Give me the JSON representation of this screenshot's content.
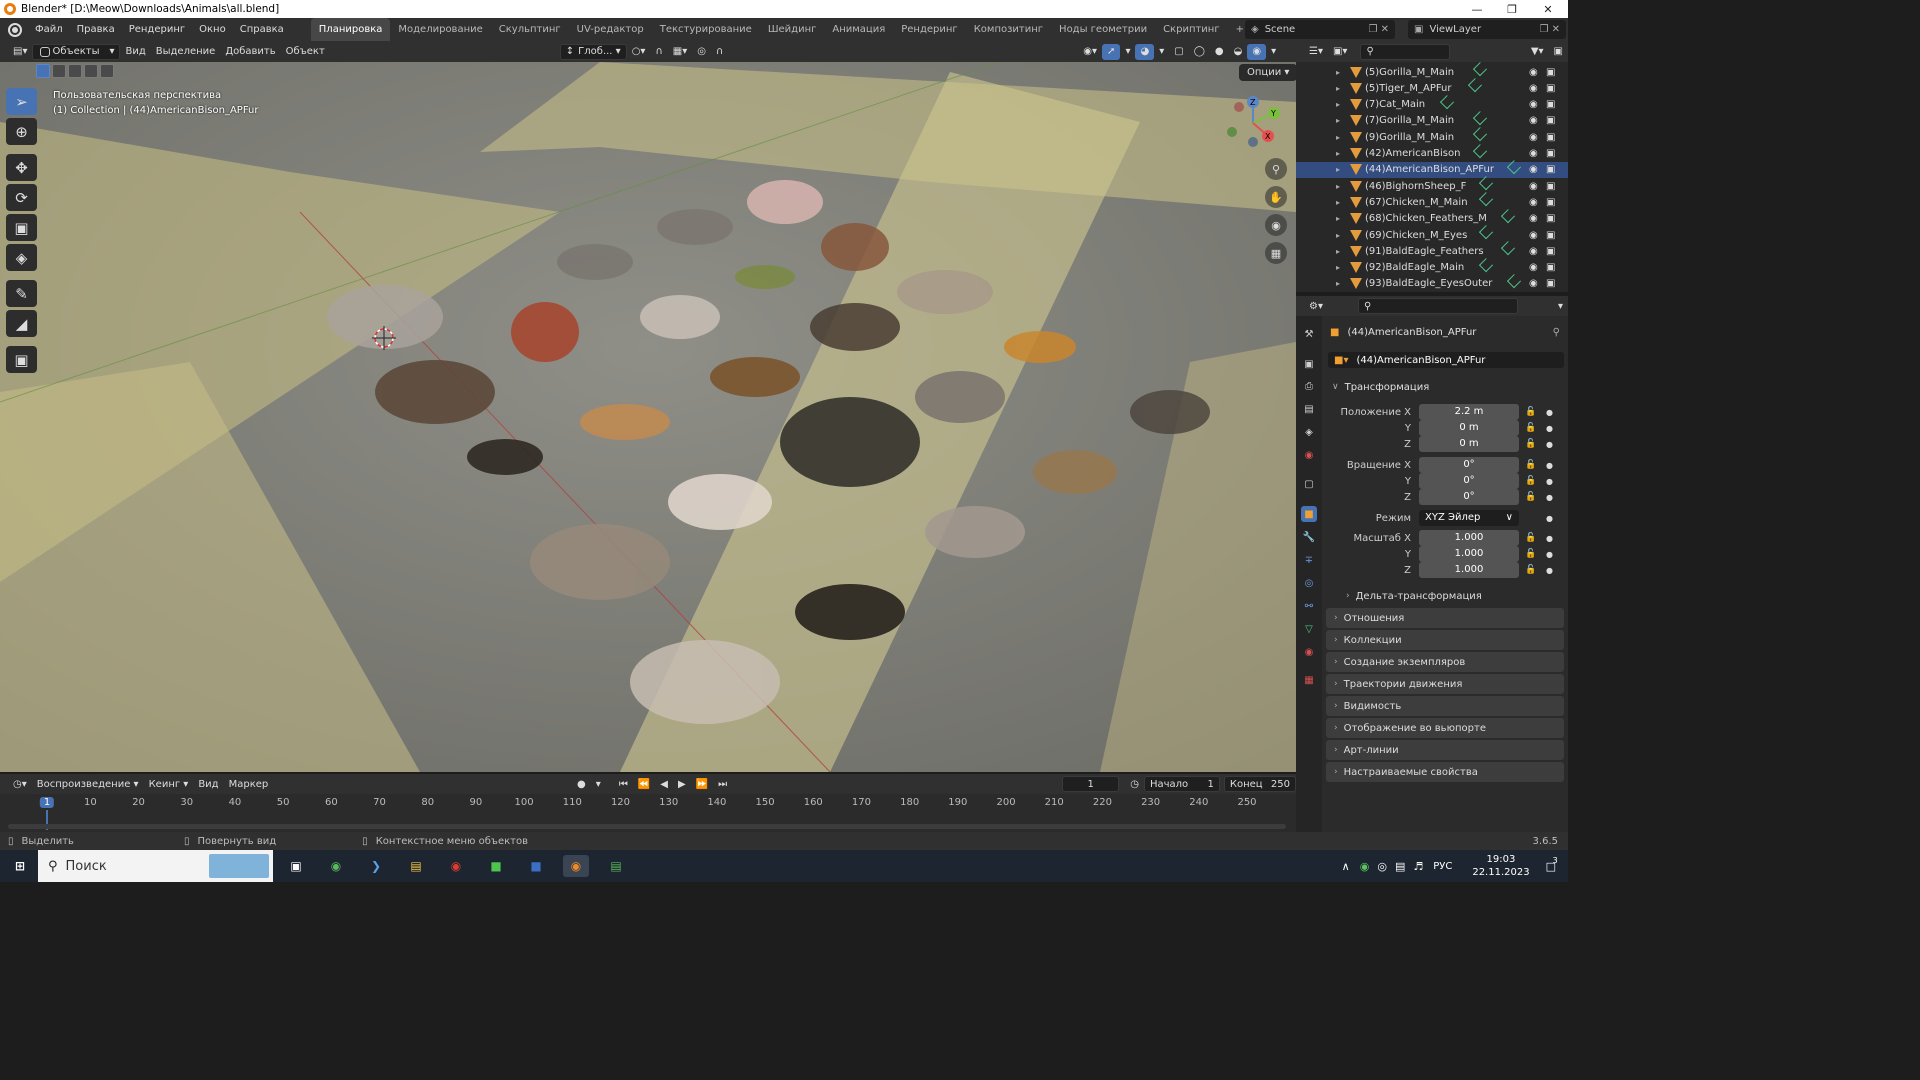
{
  "window": {
    "title": "Blender* [D:\\Meow\\Downloads\\Animals\\all.blend]"
  },
  "menu": {
    "items": [
      "Файл",
      "Правка",
      "Рендеринг",
      "Окно",
      "Справка"
    ]
  },
  "workspaces": {
    "tabs": [
      "Планировка",
      "Моделирование",
      "Скульптинг",
      "UV-редактор",
      "Текстурирование",
      "Шейдинг",
      "Анимация",
      "Рендеринг",
      "Композитинг",
      "Ноды геометрии",
      "Скриптинг"
    ],
    "active": "Планировка",
    "add": "+"
  },
  "scene": {
    "name": "Scene",
    "view_layer": "ViewLayer"
  },
  "viewport_header": {
    "mode": "Объекты",
    "menus": [
      "Вид",
      "Выделение",
      "Добавить",
      "Объект"
    ],
    "orientation": "Глоб...",
    "options": "Опции"
  },
  "viewport": {
    "view_name": "Пользовательская перспектива",
    "collection_info": "(1) Collection | (44)AmericanBison_APFur"
  },
  "gizmo": {
    "z": "Z",
    "y": "Y",
    "x": "X"
  },
  "outliner": {
    "items": [
      {
        "name": "(5)Gorilla_M_Main"
      },
      {
        "name": "(5)Tiger_M_APFur"
      },
      {
        "name": "(7)Cat_Main"
      },
      {
        "name": "(7)Gorilla_M_Main"
      },
      {
        "name": "(9)Gorilla_M_Main"
      },
      {
        "name": "(42)AmericanBison"
      },
      {
        "name": "(44)AmericanBison_APFur",
        "selected": true
      },
      {
        "name": "(46)BighornSheep_F"
      },
      {
        "name": "(67)Chicken_M_Main"
      },
      {
        "name": "(68)Chicken_Feathers_M"
      },
      {
        "name": "(69)Chicken_M_Eyes"
      },
      {
        "name": "(91)BaldEagle_Feathers"
      },
      {
        "name": "(92)BaldEagle_Main"
      },
      {
        "name": "(93)BaldEagle_EyesOuter"
      }
    ]
  },
  "properties": {
    "object_name": "(44)AmericanBison_APFur",
    "object_field": "(44)AmericanBison_APFur",
    "transform_label": "Трансформация",
    "location_label": "Положение X",
    "loc": [
      "2.2 m",
      "0 m",
      "0 m"
    ],
    "rotation_label": "Вращение X",
    "rot": [
      "0°",
      "0°",
      "0°"
    ],
    "mode_label": "Режим",
    "mode_value": "XYZ Эйлер",
    "scale_label": "Масштаб X",
    "scale": [
      "1.000",
      "1.000",
      "1.000"
    ],
    "axis_y": "Y",
    "axis_z": "Z",
    "delta": "Дельта-трансформация",
    "panels": [
      "Отношения",
      "Коллекции",
      "Создание экземпляров",
      "Траектории движения",
      "Видимость",
      "Отображение во вьюпорте",
      "Арт-линии",
      "Настраиваемые свойства"
    ]
  },
  "timeline": {
    "menus": [
      "Воспроизведение",
      "Кеинг",
      "Вид",
      "Маркер"
    ],
    "current_frame": "1",
    "start_label": "Начало",
    "start": "1",
    "end_label": "Конец",
    "end": "250",
    "ticks": [
      "1",
      "10",
      "20",
      "30",
      "40",
      "50",
      "60",
      "70",
      "80",
      "90",
      "100",
      "110",
      "120",
      "130",
      "140",
      "150",
      "160",
      "170",
      "180",
      "190",
      "200",
      "210",
      "220",
      "230",
      "240",
      "250"
    ]
  },
  "status": {
    "select": "Выделить",
    "rotate": "Повернуть вид",
    "context": "Контекстное меню объектов",
    "version": "3.6.5"
  },
  "taskbar": {
    "search": "Поиск",
    "lang": "РУС",
    "time": "19:03",
    "date": "22.11.2023",
    "notif": "3"
  },
  "colors": {
    "accent": "#4772b3",
    "bg": "#303030",
    "selected_row": "#334d80",
    "orange": "#e39b3e",
    "mesh_green": "#4cc68b"
  }
}
